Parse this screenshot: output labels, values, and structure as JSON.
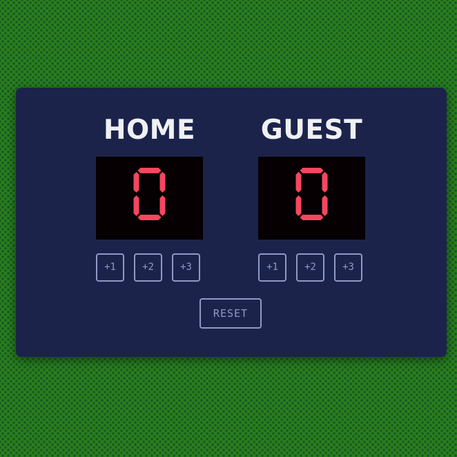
{
  "home": {
    "title": "HOME",
    "score": 0,
    "buttons": [
      "+1",
      "+2",
      "+3"
    ]
  },
  "guest": {
    "title": "GUEST",
    "score": 0,
    "buttons": [
      "+1",
      "+2",
      "+3"
    ]
  },
  "reset_label": "RESET",
  "colors": {
    "background": "#2e7d1b",
    "board": "#1c234b",
    "score_bg": "#060002",
    "digit": "#f5475f",
    "button": "#8e9bc6",
    "title": "#eef0f3"
  }
}
